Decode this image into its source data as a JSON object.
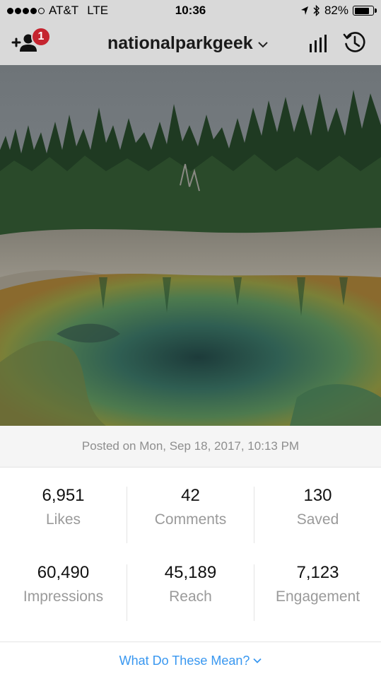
{
  "status_bar": {
    "carrier": "AT&T",
    "network": "LTE",
    "time": "10:36",
    "battery": "82%",
    "battery_level": 0.82,
    "signal_bars_filled": 4,
    "signal_bars_total": 5
  },
  "header": {
    "username": "nationalparkgeek",
    "notification_count": "1",
    "badge_color": "#c5242f",
    "icons": [
      "add-user-icon",
      "chevron-down-icon",
      "insights-bar-icon",
      "history-icon"
    ]
  },
  "post": {
    "posted_text": "Posted on Mon, Sep 18, 2017, 10:13 PM"
  },
  "metrics": [
    {
      "value": "6,951",
      "label": "Likes"
    },
    {
      "value": "42",
      "label": "Comments"
    },
    {
      "value": "130",
      "label": "Saved"
    },
    {
      "value": "60,490",
      "label": "Impressions"
    },
    {
      "value": "45,189",
      "label": "Reach"
    },
    {
      "value": "7,123",
      "label": "Engagement"
    }
  ],
  "footer": {
    "link_label": "What Do These Mean?",
    "link_color": "#3897f0"
  }
}
